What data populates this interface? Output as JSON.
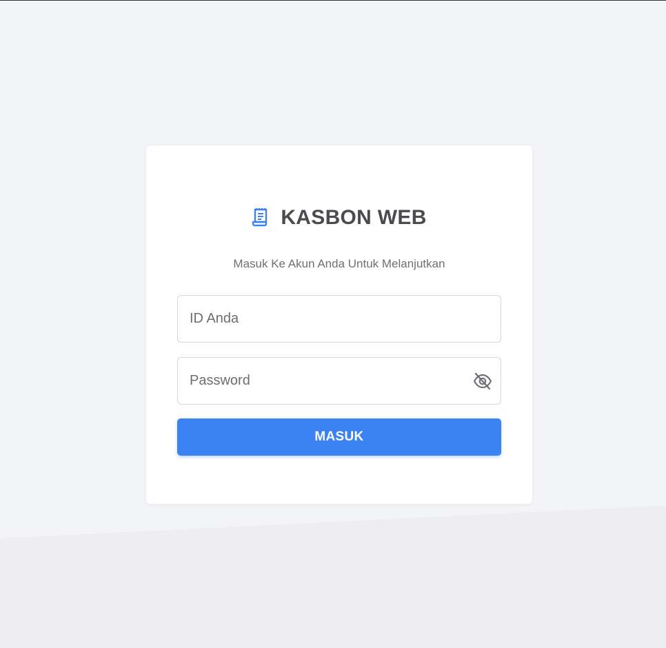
{
  "app": {
    "title": "KASBON WEB",
    "subtitle": "Masuk Ke Akun Anda Untuk Melanjutkan",
    "brand_icon": "receipt-icon"
  },
  "form": {
    "id_placeholder": "ID Anda",
    "id_value": "",
    "password_placeholder": "Password",
    "password_value": "",
    "password_toggle_icon": "eye-off-icon",
    "submit_label": "MASUK"
  },
  "colors": {
    "background": "#f3f4f8",
    "accent": "#3b82f4",
    "card": "#ffffff",
    "title": "#4a4a4f"
  }
}
